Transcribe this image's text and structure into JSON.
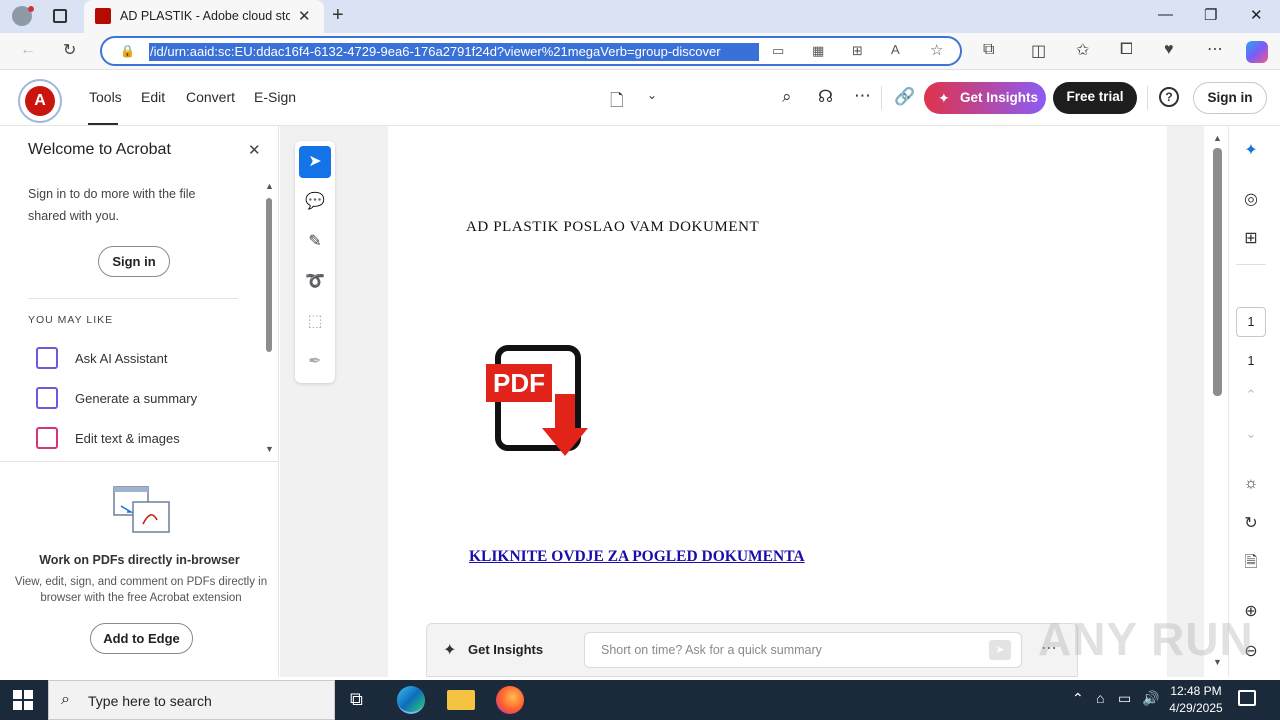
{
  "browser": {
    "tab_title": "AD PLASTIK - Adobe cloud storag",
    "url": "/id/urn:aaid:sc:EU:ddac16f4-6132-4729-9ea6-176a2791f24d?viewer%21megaVerb=group-discover"
  },
  "acrobat": {
    "menu": [
      "Tools",
      "Edit",
      "Convert",
      "E-Sign"
    ],
    "get_insights": "Get Insights",
    "free_trial": "Free trial",
    "sign_in": "Sign in"
  },
  "left_panel": {
    "title": "Welcome to Acrobat",
    "message": "Sign in to do more with the file shared with you.",
    "sign_in_button": "Sign in",
    "you_may_like": "YOU MAY LIKE",
    "items": [
      {
        "label": "Ask AI Assistant",
        "icon": "ai-assistant-icon"
      },
      {
        "label": "Generate a summary",
        "icon": "summary-icon"
      },
      {
        "label": "Edit text & images",
        "icon": "edit-text-images-icon"
      }
    ],
    "extension_title": "Work on PDFs directly in-browser",
    "extension_desc": "View, edit, sign, and comment on PDFs directly in browser with the free Acrobat extension",
    "add_button": "Add to Edge"
  },
  "document": {
    "heading": "AD PLASTIK POSLAO VAM DOKUMENT",
    "pdf_badge": "PDF",
    "link_text": "KLIKNITE OVDJE ZA POGLED DOKUMENTA"
  },
  "insights_bar": {
    "label": "Get Insights",
    "placeholder": "Short on time? Ask for a quick summary"
  },
  "pagination": {
    "current": "1",
    "total": "1"
  },
  "watermark": "ANY RUN",
  "taskbar": {
    "search_placeholder": "Type here to search",
    "time": "12:48 PM",
    "date": "4/29/2025"
  },
  "colors": {
    "accent_blue": "#1473e6",
    "insights_gradient_start": "#e0334b",
    "insights_gradient_end": "#8b5cf6",
    "acrobat_red": "#c9150e",
    "link_blue": "#1a0dab"
  }
}
